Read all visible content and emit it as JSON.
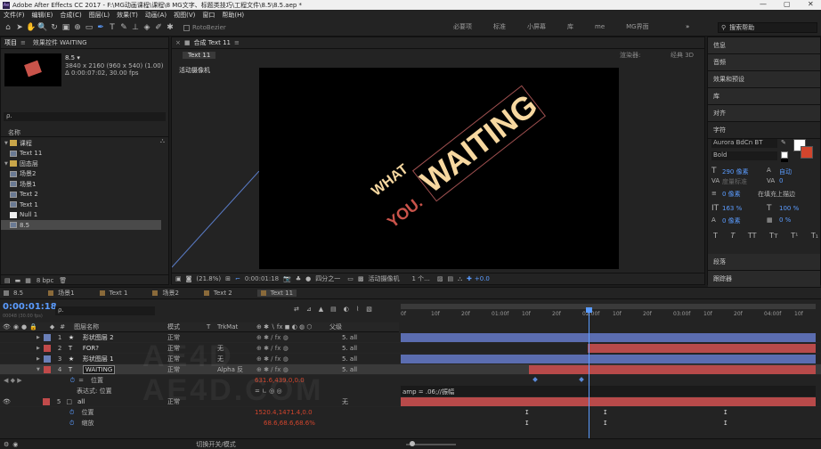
{
  "title": "Adobe After Effects CC 2017 - F:\\MG动画课程\\课程\\8 MG文字、标题类技巧\\工程文件\\8.5\\8.5.aep *",
  "menu": [
    "文件(F)",
    "编辑(E)",
    "合成(C)",
    "图层(L)",
    "效果(T)",
    "动画(A)",
    "视图(V)",
    "窗口",
    "帮助(H)"
  ],
  "toolbar": {
    "roto": "RotoBezier",
    "workspaces": [
      "必要项",
      "标准",
      "小屏幕",
      "库",
      "me",
      "MG界面"
    ],
    "search_placeholder": "搜索帮助"
  },
  "project": {
    "tab_project": "项目",
    "tab_effects": "效果控件 WAITING",
    "item_name": "8.5 ▾",
    "item_size": "3840 x 2160 (960 x 540) (1.00)",
    "item_duration": "Δ 0:00:07:02, 30.00 fps",
    "search": "ρ.",
    "col_name": "名称",
    "bpc": "8 bpc",
    "items": [
      {
        "label": "课程",
        "type": "folder",
        "indent": 0
      },
      {
        "label": "Text 11",
        "type": "comp",
        "indent": 1
      },
      {
        "label": "固态层",
        "type": "folder",
        "indent": 0
      },
      {
        "label": "场景2",
        "type": "comp",
        "indent": 1
      },
      {
        "label": "场景1",
        "type": "comp",
        "indent": 1
      },
      {
        "label": "Text 2",
        "type": "comp",
        "indent": 1
      },
      {
        "label": "Text 1",
        "type": "comp",
        "indent": 1
      },
      {
        "label": "Null 1",
        "type": "solid",
        "indent": 1
      },
      {
        "label": "8.5",
        "type": "comp",
        "indent": 1
      }
    ]
  },
  "viewer": {
    "tab_label": "合成 Text 11",
    "sub_tab": "Text 11",
    "renderer_label": "渲染器:",
    "renderer": "经典 3D",
    "camera_label": "活动摄像机",
    "comp_text_what": "WHAT",
    "comp_text_you": "YOU.",
    "comp_text_waiting": "WAITING",
    "zoom": "(21.8%)",
    "timecode": "0:00:01:18",
    "resolution": "四分之一",
    "view": "活动摄像机",
    "views": "1 个...",
    "exposure": "+0.0"
  },
  "right_panels": {
    "items": [
      "信息",
      "音频",
      "效果和预设",
      "库",
      "对齐"
    ],
    "char_title": "字符",
    "font": "Aurora BdCn BT",
    "style": "Bold",
    "size": "290 像素",
    "leading": "自动",
    "kerning": "度量标准",
    "tracking": "0",
    "stroke": "0 像素",
    "stroke_type": "在填充上描边",
    "vscale": "163 %",
    "hscale": "100 %",
    "baseline": "0 像素",
    "tsume": "0 %",
    "bottom_items": [
      "段落",
      "跟踪器"
    ]
  },
  "timeline": {
    "tabs": [
      {
        "label": "8.5",
        "color": "#7a7a7a"
      },
      {
        "label": "场景1",
        "color": "#8a6a3a"
      },
      {
        "label": "Text 1",
        "color": "#8a6a3a"
      },
      {
        "label": "场景2",
        "color": "#8a6a3a"
      },
      {
        "label": "Text 2",
        "color": "#8a6a3a"
      },
      {
        "label": "Text 11",
        "color": "#8a6a3a"
      }
    ],
    "current_time": "0:00:01:18",
    "frames_info": "00048 (30.00 fps)",
    "headers": {
      "layer_name": "图层名称",
      "mode": "模式",
      "t": "T",
      "trkmat": "TrkMat",
      "parent": "父级"
    },
    "ruler": [
      "0f",
      "10f",
      "20f",
      "01:00f",
      "10f",
      "20f",
      "02:00f",
      "10f",
      "20f",
      "03:00f",
      "10f",
      "20f",
      "04:00f",
      "10f"
    ],
    "layers": [
      {
        "num": "1",
        "icon": "★",
        "name": "形状图层 2",
        "mode": "正常",
        "trk": "",
        "parent": "5. all",
        "color": "#6a7fb8",
        "bar_color": "#5b6db0",
        "bar_start": 0.0,
        "bar_end": 1.0,
        "selected": false
      },
      {
        "num": "2",
        "icon": "T",
        "name": "FOR?",
        "mode": "正常",
        "trk": "无",
        "parent": "5. all",
        "color": "#c04a4a",
        "bar_color": "#b84a4a",
        "bar_start": 0.45,
        "bar_end": 1.0,
        "selected": false
      },
      {
        "num": "3",
        "icon": "★",
        "name": "形状图层 1",
        "mode": "正常",
        "trk": "无",
        "parent": "5. all",
        "color": "#6a7fb8",
        "bar_color": "#5b6db0",
        "bar_start": 0.0,
        "bar_end": 1.0,
        "selected": false
      },
      {
        "num": "4",
        "icon": "T",
        "name": "WAITING",
        "mode": "正常",
        "trk": "Alpha 反",
        "parent": "5. all",
        "color": "#c04a4a",
        "bar_color": "#b84a4a",
        "bar_start": 0.31,
        "bar_end": 1.0,
        "selected": true
      }
    ],
    "prop_position": "位置",
    "prop_position_value": "631.6,439.0,0.0",
    "expr_label": "表达式: 位置",
    "expr_text": "amp = .06;//振幅",
    "layer5": {
      "num": "5",
      "name": "all",
      "mode": "正常",
      "parent": "无"
    },
    "prop5_position": "位置",
    "prop5_position_value": "1520.4,1471.4,0.0",
    "prop5_scale": "缩放",
    "prop5_scale_value": "68.6,68.6,68.6%",
    "toggle_label": "切换开关/模式"
  }
}
